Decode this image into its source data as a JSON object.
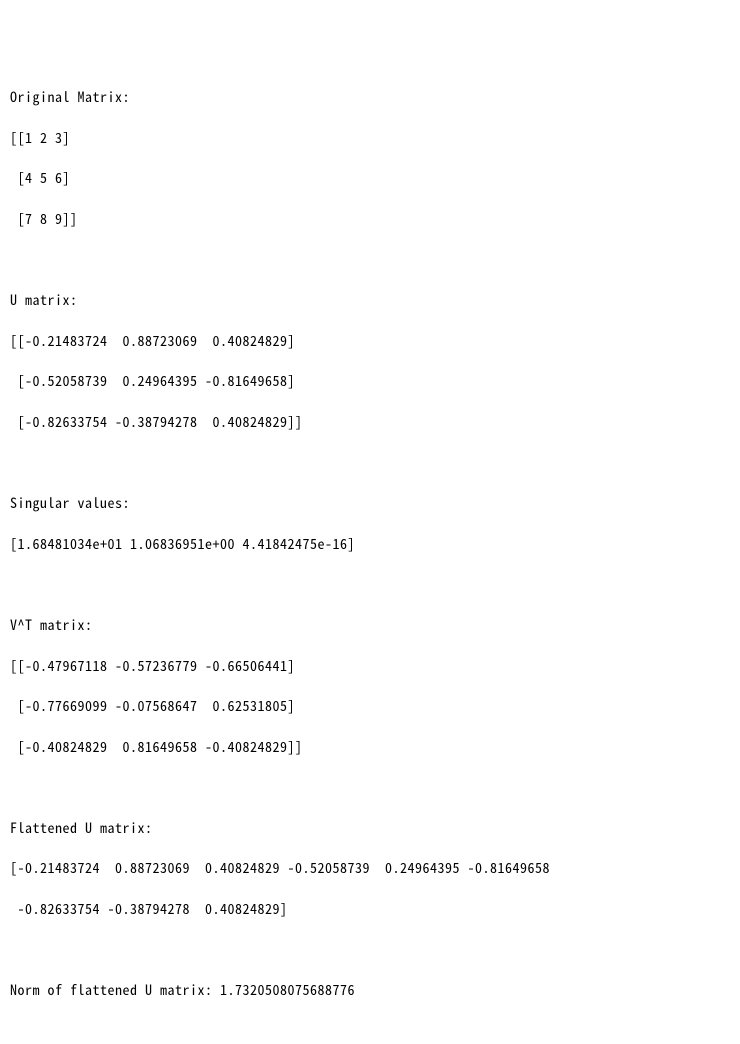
{
  "sections": {
    "original": {
      "title": "Original Matrix:",
      "rows": [
        "[[1 2 3]",
        " [4 5 6]",
        " [7 8 9]]"
      ]
    },
    "u": {
      "title": "U matrix:",
      "rows": [
        "[[-0.21483724  0.88723069  0.40824829]",
        " [-0.52058739  0.24964395 -0.81649658]",
        " [-0.82633754 -0.38794278  0.40824829]]"
      ]
    },
    "singular": {
      "title": "Singular values:",
      "rows": [
        "[1.68481034e+01 1.06836951e+00 4.41842475e-16]"
      ]
    },
    "vt": {
      "title": "V^T matrix:",
      "rows": [
        "[[-0.47967118 -0.57236779 -0.66506441]",
        " [-0.77669099 -0.07568647  0.62531805]",
        " [-0.40824829  0.81649658 -0.40824829]]"
      ]
    },
    "flat_u": {
      "title": "Flattened U matrix:",
      "rows": [
        "[-0.21483724  0.88723069  0.40824829 -0.52058739  0.24964395 -0.81649658",
        " -0.82633754 -0.38794278  0.40824829]"
      ]
    },
    "norm": {
      "line": "Norm of flattened U matrix: 1.7320508075688776"
    }
  }
}
